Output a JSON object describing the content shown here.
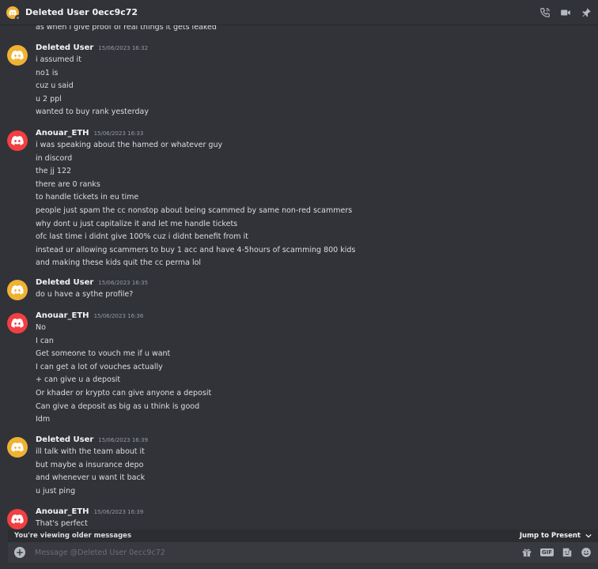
{
  "header": {
    "title": "Deleted User 0ecc9c72"
  },
  "partial_line": "as when i give proof of real things it gets leaked",
  "messages": [
    {
      "author": "Deleted User",
      "time": "15/06/2023 16:32",
      "avatar": "yellow",
      "lines": [
        "i assumed it",
        "no1 is",
        "cuz u said",
        "u 2 ppl",
        "wanted to buy rank yesterday"
      ]
    },
    {
      "author": "Anouar_ETH",
      "time": "15/06/2023 16:33",
      "avatar": "red",
      "lines": [
        "i was speaking about the hamed or whatever guy",
        "in discord",
        "the jj 122",
        "there are 0 ranks",
        "to handle tickets in eu time",
        "people just spam the cc nonstop about being scammed by same non-red scammers",
        "why dont u just capitalize it and let me handle tickets",
        "ofc last time i didnt give 100% cuz i didnt benefit from it",
        "instead ur allowing scammers to buy 1 acc and have 4-5hours of scamming 800 kids",
        "and making these kids quit the cc perma lol"
      ]
    },
    {
      "author": "Deleted User",
      "time": "15/06/2023 16:35",
      "avatar": "yellow",
      "lines": [
        "do u have a sythe profile?"
      ]
    },
    {
      "author": "Anouar_ETH",
      "time": "15/06/2023 16:36",
      "avatar": "red",
      "lines": [
        "No",
        "I can",
        "Get someone to vouch me if u want",
        "I can get a lot of vouches actually",
        "+ can give u a deposit",
        "Or khader or krypto can give anyone a deposit",
        "Can give a deposit as big as u think is good",
        "Idm"
      ]
    },
    {
      "author": "Deleted User",
      "time": "15/06/2023 16:39",
      "avatar": "yellow",
      "lines": [
        "ill talk with the team about it",
        "but maybe a insurance depo",
        "and whenever u want it back",
        "u just ping"
      ]
    },
    {
      "author": "Anouar_ETH",
      "time": "15/06/2023 16:39",
      "avatar": "red",
      "lines": [
        "That's perfect"
      ]
    }
  ],
  "banner": {
    "older": "You're viewing older messages",
    "jump": "Jump to Present"
  },
  "input": {
    "placeholder": "Message @Deleted User 0ecc9c72"
  },
  "icons": [
    "phone-icon",
    "video-icon",
    "pin-icon",
    "gift-icon",
    "gif-icon",
    "sticker-icon",
    "emoji-icon",
    "discord-logo-icon"
  ],
  "colors": {
    "background": "#313338",
    "avatar_yellow": "#f0b232",
    "avatar_red": "#f23f42",
    "input": "#383a40"
  }
}
